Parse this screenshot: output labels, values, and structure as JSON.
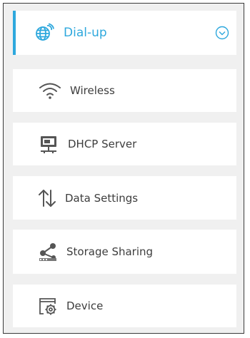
{
  "menu": {
    "accent_color": "#2ea8dd",
    "items": [
      {
        "label": "Dial-up",
        "icon": "globe-icon",
        "active": true
      },
      {
        "label": "Wireless",
        "icon": "wifi-icon",
        "active": false
      },
      {
        "label": "DHCP Server",
        "icon": "dhcp-server-icon",
        "active": false
      },
      {
        "label": "Data Settings",
        "icon": "data-transfer-icon",
        "active": false
      },
      {
        "label": "Storage Sharing",
        "icon": "share-icon",
        "active": false
      },
      {
        "label": "Device",
        "icon": "device-gear-icon",
        "active": false
      }
    ]
  }
}
